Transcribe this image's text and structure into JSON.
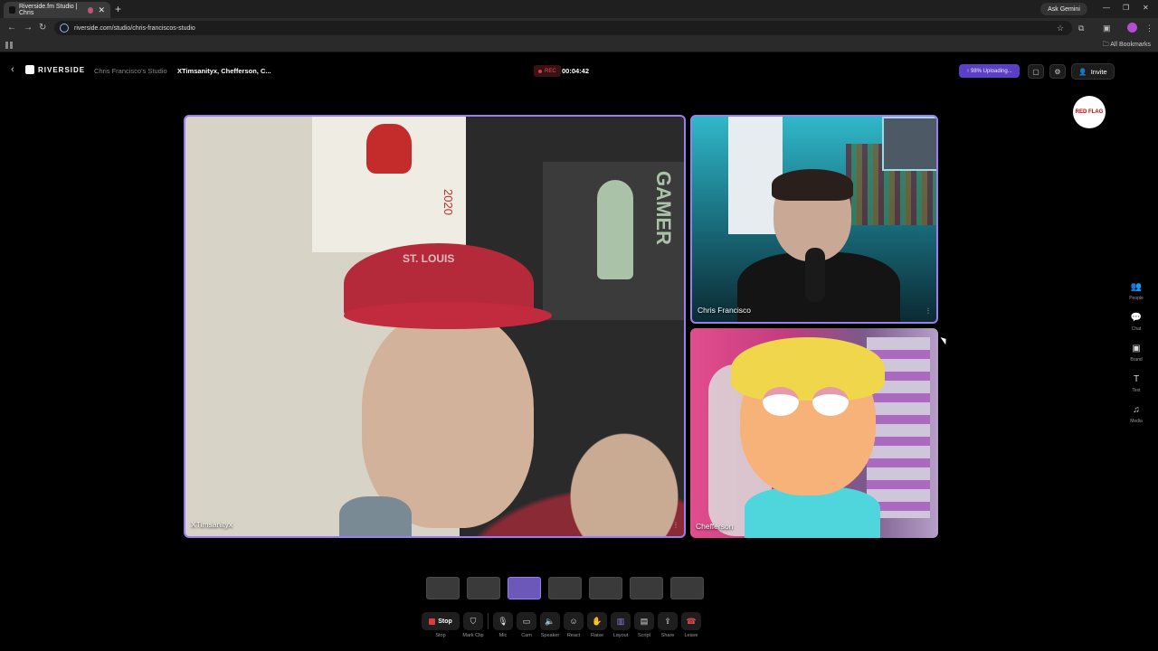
{
  "browser": {
    "tab_title": "Riverside.fm Studio | Chris",
    "tab_close": "✕",
    "new_tab": "+",
    "gemini_label": "Ask Gemini",
    "url": "riverside.com/studio/chris-franciscos-studio",
    "all_bookmarks": "All Bookmarks"
  },
  "header": {
    "logo_text": "RIVERSIDE",
    "studio_name": "Chris Francisco's Studio",
    "participants": "XTimsanityx, Chefferson, C...",
    "rec_label": "REC",
    "timer": "00:04:42",
    "upload_status": "98% Uploading...",
    "invite_label": "Invite"
  },
  "brand_logo_text": "RED FLAG",
  "tiles": [
    {
      "name": "XTimsanityx",
      "poster_text": "2020",
      "sign_text": "GAMER",
      "cap_text": "ST. LOUIS"
    },
    {
      "name": "Chris Francisco"
    },
    {
      "name": "Chefferson"
    }
  ],
  "layout_options": [
    "single",
    "three-up",
    "grid-active",
    "side-left",
    "solo-pip",
    "solo-large",
    "side-right"
  ],
  "active_layout_index": 2,
  "controls": [
    {
      "key": "stop",
      "label": "Stop",
      "btn_text": "Stop",
      "icon": "stop-icon"
    },
    {
      "key": "mark-clip",
      "label": "Mark Clip",
      "icon": "shield-icon"
    },
    {
      "key": "mic",
      "label": "Mic",
      "icon": "mic-icon"
    },
    {
      "key": "cam",
      "label": "Cam",
      "icon": "camera-icon"
    },
    {
      "key": "speaker",
      "label": "Speaker",
      "icon": "speaker-icon"
    },
    {
      "key": "react",
      "label": "React",
      "icon": "smile-icon"
    },
    {
      "key": "raise",
      "label": "Raise",
      "icon": "hand-icon"
    },
    {
      "key": "layout",
      "label": "Layout",
      "icon": "layout-icon"
    },
    {
      "key": "script",
      "label": "Script",
      "icon": "script-icon"
    },
    {
      "key": "share",
      "label": "Share",
      "icon": "share-icon"
    },
    {
      "key": "leave",
      "label": "Leave",
      "icon": "phone-icon"
    }
  ],
  "sidebar": [
    {
      "label": "People",
      "icon": "people-icon"
    },
    {
      "label": "Chat",
      "icon": "chat-icon"
    },
    {
      "label": "Brand",
      "icon": "brand-icon"
    },
    {
      "label": "Text",
      "icon": "text-icon"
    },
    {
      "label": "Media",
      "icon": "music-icon"
    }
  ],
  "colors": {
    "accent": "#9a7df0",
    "rec": "#e03a3a",
    "upload": "#5b3fc7"
  }
}
